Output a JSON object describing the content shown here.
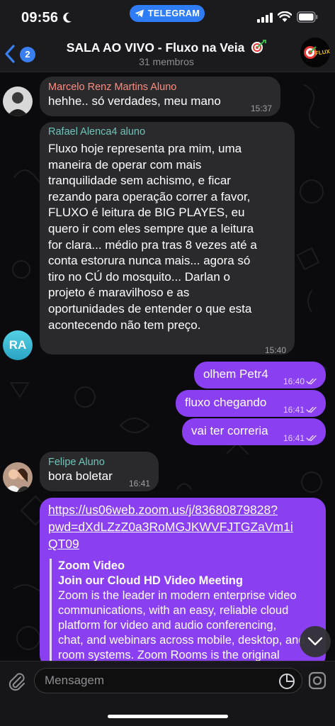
{
  "status_bar": {
    "time": "09:56",
    "app_pill": "TELEGRAM"
  },
  "header": {
    "back_badge": "2",
    "title": "SALA AO VIVO - Fluxo na Veia",
    "subtitle": "31 membros",
    "avatar_text": "FLUXO"
  },
  "messages": [
    {
      "sender": "Marcelo Renz Martins Aluno",
      "text": "hehhe.. só verdades, meu mano",
      "time": "15:37"
    },
    {
      "sender": "Rafael Alenca4 aluno",
      "lines": [
        "Fluxo hoje representa pra mim, uma",
        "maneira de operar com mais",
        "tranquilidade sem achismo, e ficar",
        "rezando para operação correr a favor,",
        "FLUXO é leitura de BIG PLAYES, eu",
        "quero ir com eles sempre que a leitura",
        "for clara... médio pra tras 8 vezes até a",
        "conta estorura nunca mais... agora só",
        "tiro no CÚ do mosquito... Darlan o",
        "projeto é maravilhoso e as",
        "oportunidades de entender o que esta",
        "acontecendo não tem preço."
      ],
      "time": "15:40",
      "avatar_initials": "RA"
    },
    {
      "text": "olhem Petr4",
      "time": "16:40"
    },
    {
      "text": "fluxo chegando",
      "time": "16:41"
    },
    {
      "text": "vai ter correria",
      "time": "16:41"
    },
    {
      "sender": "Felipe Aluno",
      "text": "bora boletar",
      "time": "16:41"
    },
    {
      "link_lines": [
        "https://us06web.zoom.us/j/83680879828?",
        "pwd=dXdLZzZ0a3RoMGJKWVFJTGZaVm1i",
        "QT09"
      ],
      "preview_site": "Zoom Video",
      "preview_title": "Join our Cloud HD Video Meeting",
      "preview_lines": [
        "Zoom is the leader in modern enterprise video",
        "communications, with an easy, reliable cloud",
        "platform for video and audio conferencing,",
        "chat, and webinars across mobile, desktop, and",
        "room systems. Zoom Rooms is the original"
      ]
    }
  ],
  "input": {
    "placeholder": "Mensagem"
  },
  "colors": {
    "outgoing_bubble": "#8a3ff0",
    "incoming_bubble": "#2c2c2e",
    "accent_blue": "#3a7ff0",
    "sender_teal": "#6fc3b9",
    "sender_coral": "#ff8b7e"
  }
}
